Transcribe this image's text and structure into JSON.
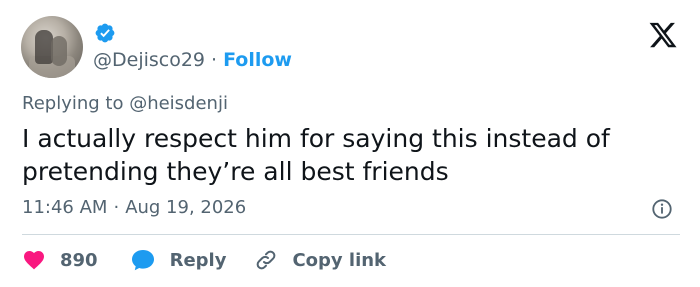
{
  "author": {
    "handle": "@Dejisco29",
    "separator": "·",
    "follow_label": "Follow",
    "verified": true
  },
  "tweet": {
    "replying_to": "Replying to @heisdenji",
    "text": "I actually respect him for saying this instead of pretending they’re all best friends",
    "time": "11:46 AM",
    "separator": "·",
    "date": "Aug 19, 2026"
  },
  "actions": {
    "like_count": "890",
    "reply_label": "Reply",
    "copy_link_label": "Copy link"
  },
  "colors": {
    "accent": "#1d9bf0",
    "like": "#f91880",
    "muted": "#536471",
    "text": "#0f1419"
  },
  "icons": [
    "verified-badge-icon",
    "x-logo-icon",
    "info-icon",
    "heart-icon",
    "reply-bubble-icon",
    "link-icon"
  ]
}
